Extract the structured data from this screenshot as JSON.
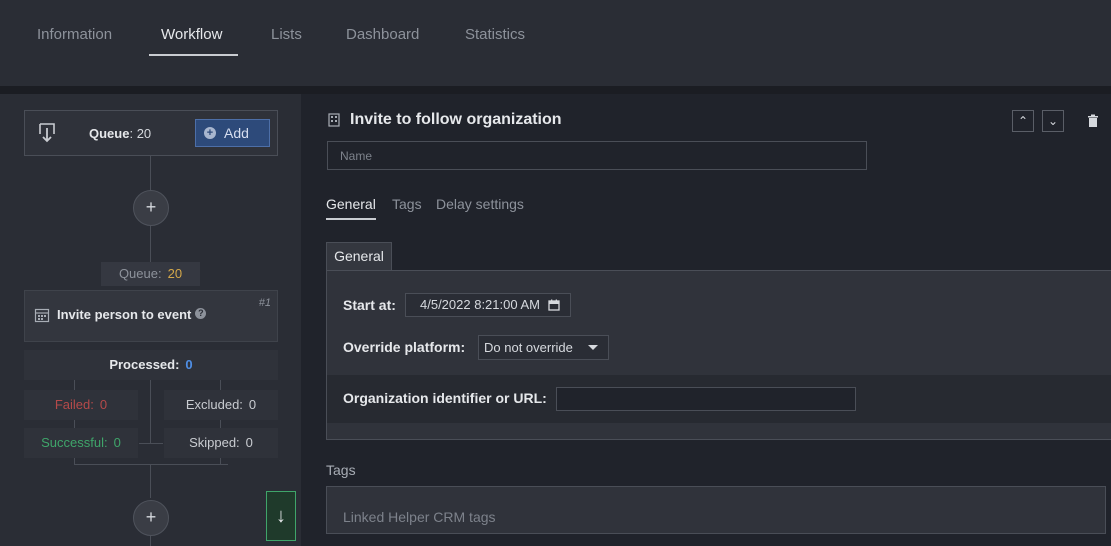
{
  "nav": {
    "tabs": [
      {
        "label": "Information"
      },
      {
        "label": "Workflow"
      },
      {
        "label": "Lists"
      },
      {
        "label": "Dashboard"
      },
      {
        "label": "Statistics"
      }
    ],
    "active": "Workflow"
  },
  "workflow": {
    "queue_box": {
      "label": "Queue",
      "count": ": 20",
      "add_label": "Add"
    },
    "action_queue": {
      "label": "Queue:",
      "count": "20"
    },
    "action": {
      "title": "Invite person to event",
      "number": "#1"
    },
    "processed": {
      "label": "Processed:",
      "count": "0"
    },
    "stats": {
      "failed": {
        "label": "Failed:",
        "value": "0"
      },
      "excluded": {
        "label": "Excluded:",
        "value": "0"
      },
      "successful": {
        "label": "Successful:",
        "value": "0"
      },
      "skipped": {
        "label": "Skipped:",
        "value": "0"
      }
    },
    "plus_glyph": "+",
    "down_glyph": "↓"
  },
  "editor": {
    "title": "Invite to follow organization",
    "name_placeholder": "Name",
    "up_glyph": "⌃",
    "down_glyph": "⌄",
    "subtabs": [
      {
        "label": "General"
      },
      {
        "label": "Tags"
      },
      {
        "label": "Delay settings"
      }
    ],
    "section_tab": "General",
    "fields": {
      "start_at_label": "Start at:",
      "start_at_value": "4/5/2022 8:21:00 AM",
      "override_label": "Override platform:",
      "override_value": "Do not override",
      "org_label": "Organization identifier or URL:"
    },
    "tags_label": "Tags",
    "tags_placeholder": "Linked Helper CRM tags"
  },
  "colors": {
    "accent_blue": "#2d4a7a",
    "queue_count": "#d4a84a",
    "processed_count": "#4f8fe6",
    "failed": "#b54a4a",
    "success": "#3fa56a"
  }
}
